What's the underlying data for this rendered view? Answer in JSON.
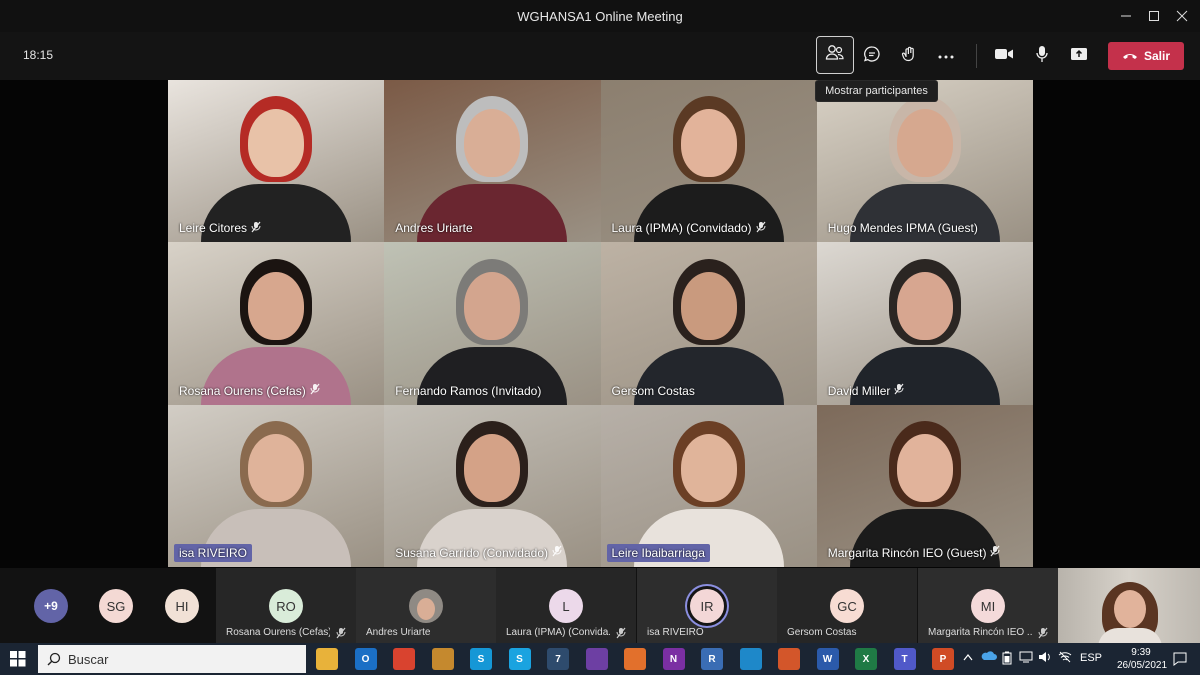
{
  "window": {
    "title": "WGHANSA1 Online Meeting",
    "controls": [
      "minimize-icon",
      "maximize-icon",
      "close-icon"
    ]
  },
  "toolbar": {
    "timer": "18:15",
    "buttons": [
      "participants-icon",
      "chat-icon",
      "reactions-icon",
      "more-icon",
      "camera-icon",
      "mic-icon",
      "share-icon"
    ],
    "leave_label": "Salir",
    "tooltip": "Mostrar participantes"
  },
  "grid": [
    {
      "name": "Leire Citores",
      "muted": true,
      "bg": "#e9e4de",
      "skin": "#e8c2a8",
      "hair": "#b52b25",
      "top": "#222"
    },
    {
      "name": "Andres Uriarte",
      "muted": false,
      "bg": "#7b5a46",
      "skin": "#d9ae96",
      "hair": "#bdbdbd",
      "top": "#6a2630"
    },
    {
      "name": "Laura (IPMA) (Convidado)",
      "muted": true,
      "bg": "#8c7f6f",
      "skin": "#e2b39a",
      "hair": "#5b3a24",
      "top": "#1c1c1c"
    },
    {
      "name": "Hugo Mendes IPMA (Guest)",
      "muted": false,
      "bg": "#d9d2c6",
      "skin": "#d6a88f",
      "hair": "#c8b6a8",
      "top": "#2f3136"
    },
    {
      "name": "Rosana Ourens (Cefas)",
      "muted": true,
      "bg": "#d8d2c8",
      "skin": "#d7a78e",
      "hair": "#1b1411",
      "top": "#b0738c"
    },
    {
      "name": "Fernando Ramos (Invitado)",
      "muted": false,
      "bg": "#bfc2b5",
      "skin": "#d3a58e",
      "hair": "#7c7b78",
      "top": "#1f1f22"
    },
    {
      "name": "Gersom Costas",
      "muted": false,
      "bg": "#bdb2a4",
      "skin": "#c99a7e",
      "hair": "#2a211d",
      "top": "#23262c"
    },
    {
      "name": "David Miller",
      "muted": true,
      "bg": "#dcd8d2",
      "skin": "#d7a690",
      "hair": "#2b2623",
      "top": "#20242a"
    },
    {
      "name": "isa RIVEIRO",
      "muted": false,
      "bg": "#d2cdc5",
      "skin": "#dfb39a",
      "hair": "#8a6a4e",
      "top": "#c8bfb9",
      "highlight": true
    },
    {
      "name": "Susana Garrido (Convidado)",
      "muted": true,
      "bg": "#c4c0b8",
      "skin": "#d4a287",
      "hair": "#2b201b",
      "top": "#d9d2cc"
    },
    {
      "name": "Leire Ibaibarriaga",
      "muted": false,
      "bg": "#b7b0a8",
      "skin": "#e0b49a",
      "hair": "#6b3f25",
      "top": "#e8e2dc",
      "highlight": true
    },
    {
      "name": "Margarita Rincón  IEO (Guest)",
      "muted": true,
      "bg": "#7d6a5a",
      "skin": "#e1b39b",
      "hair": "#4a2a1b",
      "top": "#1b1b1b"
    }
  ],
  "strip": {
    "overflow": "+9",
    "extra_avatars": [
      {
        "initials": "SG",
        "color": "#f4d9d4"
      },
      {
        "initials": "HI",
        "color": "#f1e1d6"
      }
    ],
    "participants": [
      {
        "initials": "RO",
        "color": "#d9ecd9",
        "label": "Rosana Ourens (Cefas)",
        "muted": true
      },
      {
        "initials": "",
        "photo": true,
        "label": "Andres Uriarte",
        "muted": false
      },
      {
        "initials": "L",
        "color": "#ecd9ea",
        "label": "Laura (IPMA) (Convida...",
        "muted": true
      },
      {
        "initials": "IR",
        "color": "#f3d7d7",
        "label": "isa RIVEIRO",
        "muted": false,
        "speaking": true
      },
      {
        "initials": "GC",
        "color": "#f7dcd3",
        "label": "Gersom Costas",
        "muted": false
      },
      {
        "initials": "MI",
        "color": "#f4dada",
        "label": "Margarita Rincón IEO ...",
        "muted": true
      }
    ]
  },
  "taskbar": {
    "search_placeholder": "Buscar",
    "apps": [
      {
        "icon": "folder-icon",
        "color": "#e8b23a",
        "glyph": ""
      },
      {
        "icon": "outlook-icon",
        "color": "#1b6fc5",
        "glyph": "O"
      },
      {
        "icon": "chrome-icon",
        "color": "#d9432f",
        "glyph": ""
      },
      {
        "icon": "sailboat-icon",
        "color": "#c5892e",
        "glyph": ""
      },
      {
        "icon": "skype-icon",
        "color": "#1597d6",
        "glyph": "S"
      },
      {
        "icon": "skype-alt-icon",
        "color": "#1aa3e0",
        "glyph": "S"
      },
      {
        "icon": "badge-7-icon",
        "color": "#2e4b6d",
        "glyph": "7"
      },
      {
        "icon": "app-purple-icon",
        "color": "#6d3fa3",
        "glyph": ""
      },
      {
        "icon": "app-orange-icon",
        "color": "#e2702c",
        "glyph": ""
      },
      {
        "icon": "onenote-icon",
        "color": "#7b2fa3",
        "glyph": "N"
      },
      {
        "icon": "r-icon",
        "color": "#3a6db4",
        "glyph": "R"
      },
      {
        "icon": "app-blue-icon",
        "color": "#1e88c9",
        "glyph": ""
      },
      {
        "icon": "home-icon",
        "color": "#d3562a",
        "glyph": ""
      },
      {
        "icon": "word-icon",
        "color": "#2b5aaa",
        "glyph": "W"
      },
      {
        "icon": "excel-icon",
        "color": "#1f7a45",
        "glyph": "X"
      },
      {
        "icon": "teams-icon",
        "color": "#5059c9",
        "glyph": "T"
      },
      {
        "icon": "powerpoint-icon",
        "color": "#d04b25",
        "glyph": "P"
      }
    ],
    "tray": {
      "lang": "ESP",
      "time": "9:39",
      "date": "26/05/2021"
    }
  }
}
